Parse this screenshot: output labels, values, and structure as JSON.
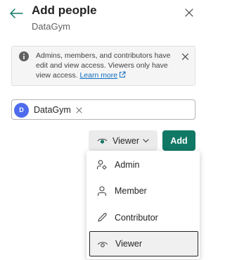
{
  "header": {
    "title": "Add people",
    "subtitle": "DataGym"
  },
  "info_bar": {
    "message": "Admins, members, and contributors have edit and view access. Viewers only have view access.",
    "link_text": "Learn more"
  },
  "people_input": {
    "chips": [
      {
        "initial": "D",
        "name": "DataGym",
        "avatar_color": "#4f6bed"
      }
    ]
  },
  "role_button": {
    "label": "Viewer",
    "icon": "eye-icon"
  },
  "add_button": {
    "label": "Add",
    "color": "#117865"
  },
  "role_menu": {
    "items": [
      {
        "label": "Admin",
        "icon": "admin-icon"
      },
      {
        "label": "Member",
        "icon": "person-icon"
      },
      {
        "label": "Contributor",
        "icon": "pencil-icon"
      },
      {
        "label": "Viewer",
        "icon": "eye-icon",
        "selected": true
      }
    ]
  }
}
